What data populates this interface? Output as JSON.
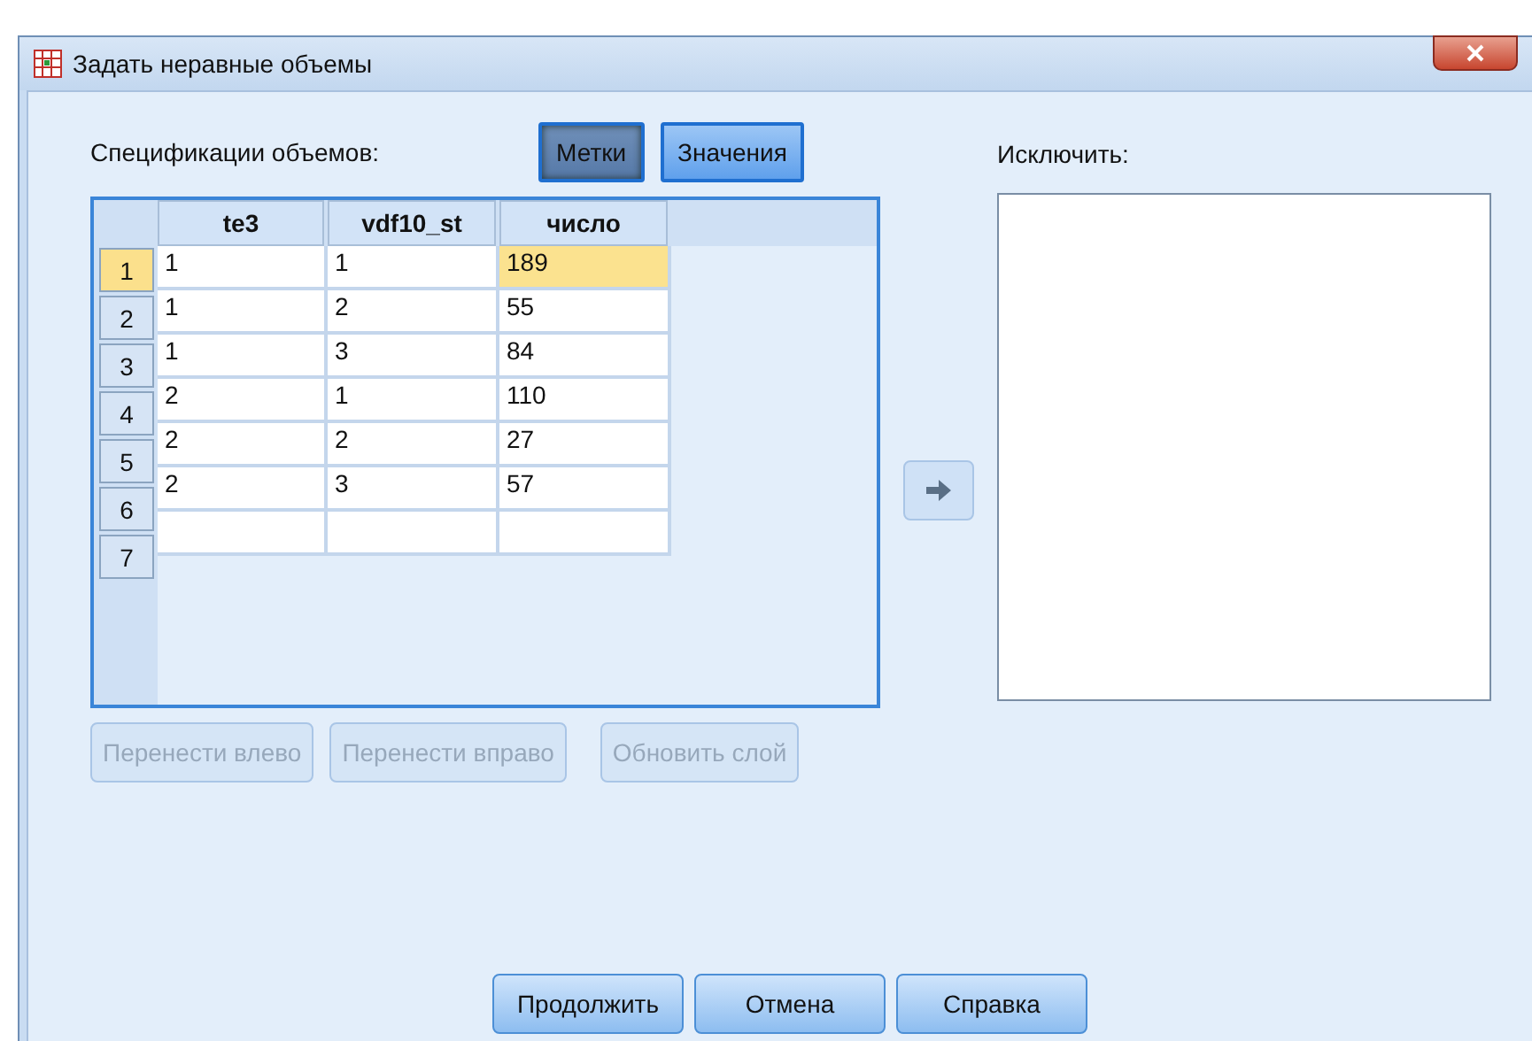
{
  "window": {
    "title": "Задать неравные объемы"
  },
  "spec_label": "Спецификации объемов:",
  "mode_buttons": [
    {
      "label": "Метки",
      "selected": true
    },
    {
      "label": "Значения",
      "selected": false
    }
  ],
  "table": {
    "columns": [
      "te3",
      "vdf10_st",
      "число"
    ],
    "rows": [
      {
        "number": "1",
        "selected": true,
        "cells": [
          {
            "text": "1",
            "selected": false
          },
          {
            "text": "1",
            "selected": false
          },
          {
            "text": "189",
            "selected": true
          }
        ]
      },
      {
        "number": "2",
        "selected": false,
        "cells": [
          {
            "text": "1",
            "selected": false
          },
          {
            "text": "2",
            "selected": false
          },
          {
            "text": "55",
            "selected": false
          }
        ]
      },
      {
        "number": "3",
        "selected": false,
        "cells": [
          {
            "text": "1",
            "selected": false
          },
          {
            "text": "3",
            "selected": false
          },
          {
            "text": "84",
            "selected": false
          }
        ]
      },
      {
        "number": "4",
        "selected": false,
        "cells": [
          {
            "text": "2",
            "selected": false
          },
          {
            "text": "1",
            "selected": false
          },
          {
            "text": "110",
            "selected": false
          }
        ]
      },
      {
        "number": "5",
        "selected": false,
        "cells": [
          {
            "text": "2",
            "selected": false
          },
          {
            "text": "2",
            "selected": false
          },
          {
            "text": "27",
            "selected": false
          }
        ]
      },
      {
        "number": "6",
        "selected": false,
        "cells": [
          {
            "text": "2",
            "selected": false
          },
          {
            "text": "3",
            "selected": false
          },
          {
            "text": "57",
            "selected": false
          }
        ]
      },
      {
        "number": "7",
        "selected": false,
        "cells": [
          {
            "selected": false
          },
          {
            "selected": false
          },
          {
            "selected": false
          }
        ]
      }
    ]
  },
  "table_buttons": [
    {
      "label": "Перенести влево",
      "disabled": true
    },
    {
      "label": "Перенести вправо",
      "disabled": true
    },
    {
      "label": "Обновить слой",
      "disabled": true
    }
  ],
  "exclude_label": "Исключить:",
  "footer_buttons": [
    "Продолжить",
    "Отмена",
    "Справка"
  ]
}
